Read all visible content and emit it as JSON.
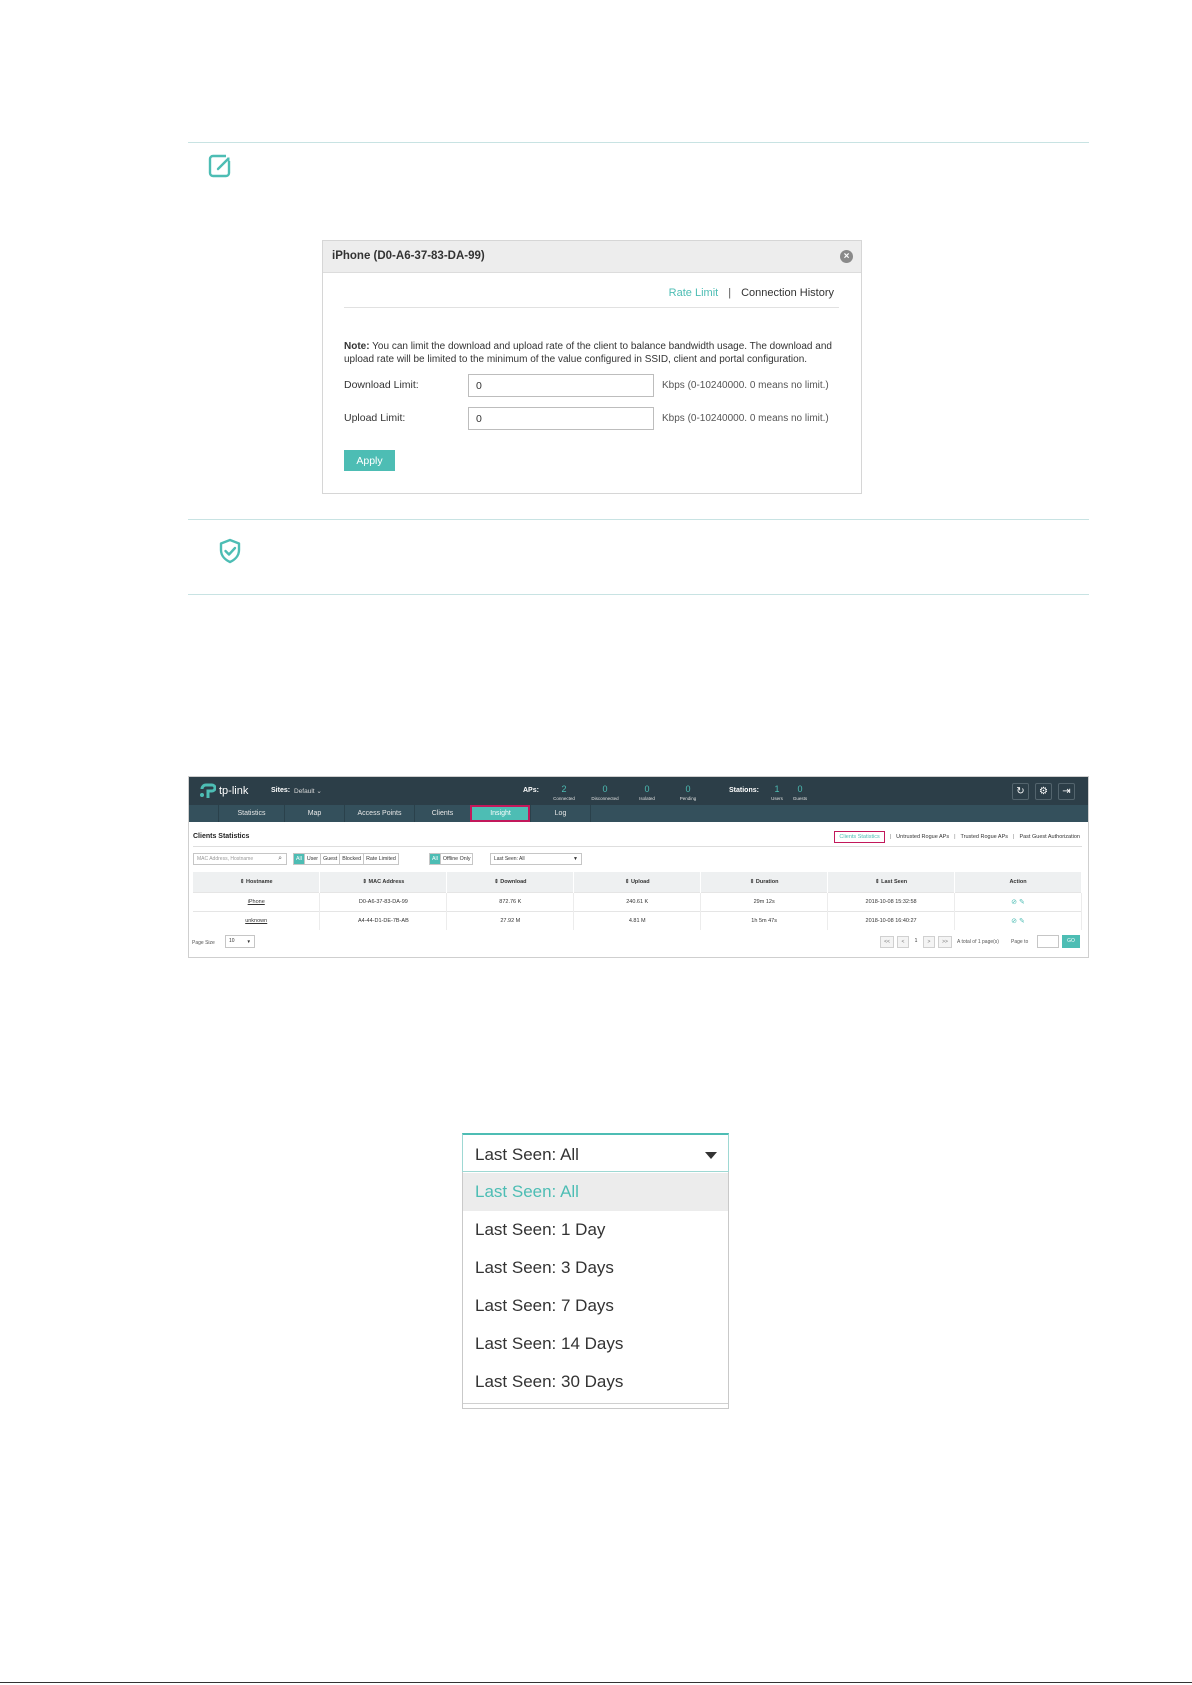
{
  "dialog": {
    "title": "iPhone (D0-A6-37-83-DA-99)",
    "close_glyph": "×",
    "tabs": [
      "Rate Limit",
      "Connection History"
    ],
    "tab_separator": "|",
    "note_label": "Note:",
    "note_text": " You can limit the download and upload rate of the client to balance bandwidth usage. The download and upload rate will be limited to the minimum of the value configured in SSID, client and portal configuration.",
    "download_label": "Download Limit:",
    "download_value": "0",
    "download_hint": "Kbps (0-10240000. 0 means no limit.)",
    "upload_label": "Upload Limit:",
    "upload_value": "0",
    "upload_hint": "Kbps (0-10240000. 0 means no limit.)",
    "apply_label": "Apply"
  },
  "controller": {
    "logo_text": "tp-link",
    "sites_label": "Sites:",
    "sites_value": "Default ⌄",
    "aps_label": "APs:",
    "aps_stats": [
      {
        "num": "2",
        "label": "Connected"
      },
      {
        "num": "0",
        "label": "Disconnected"
      },
      {
        "num": "0",
        "label": "Isolated"
      },
      {
        "num": "0",
        "label": "Pending"
      }
    ],
    "stations_label": "Stations:",
    "stations_stats": [
      {
        "num": "1",
        "label": "Users"
      },
      {
        "num": "0",
        "label": "Guests"
      }
    ],
    "top_icons": [
      "↻",
      "⚙",
      "⇥"
    ],
    "nav_tabs": [
      "Statistics",
      "Map",
      "Access Points",
      "Clients",
      "Insight",
      "Log"
    ],
    "active_nav": "Insight",
    "section_title": "Clients Statistics",
    "insight_tabs": [
      "Clients Statistics",
      "Untrusted Rogue APs",
      "Trusted Rogue APs",
      "Past Guest Authorization"
    ],
    "search_placeholder": "MAC Address, Hostname",
    "type_filters": [
      "All",
      "User",
      "Guest",
      "Blocked",
      "Rate Limited"
    ],
    "status_filters": [
      "All",
      "Offline Only"
    ],
    "last_seen_select": "Last Seen: All",
    "table": {
      "headers": [
        "⇕ Hostname",
        "⇕ MAC Address",
        "⇕ Download",
        "⇕ Upload",
        "⇕ Duration",
        "⇕ Last Seen",
        "Action"
      ],
      "rows": [
        [
          "iPhone",
          "D0-A6-37-83-DA-99",
          "872.76 K",
          "240.61 K",
          "29m 12s",
          "2018-10-08 15:32:58"
        ],
        [
          "unknown",
          "A4-44-D1-DE-7B-AB",
          "27.92 M",
          "4.81 M",
          "1h 5m 47s",
          "2018-10-08 16:40:27"
        ]
      ]
    },
    "page_size_label": "Page Size",
    "page_size_value": "10",
    "pager": [
      "<<",
      "<",
      "1",
      ">",
      ">>"
    ],
    "page_total": "A total of 1 page(s)",
    "page_to_label": "Page to",
    "go_label": "GO"
  },
  "last_seen_dropdown": {
    "selected": "Last Seen: All",
    "options": [
      "Last Seen: All",
      "Last Seen: 1 Day",
      "Last Seen: 3 Days",
      "Last Seen: 7 Days",
      "Last Seen: 14 Days",
      "Last Seen: 30 Days"
    ]
  },
  "colors": {
    "accent": "#4dbdb4",
    "highlight": "#c2185b",
    "topbar": "#2c3e48",
    "navbar": "#34505c"
  }
}
